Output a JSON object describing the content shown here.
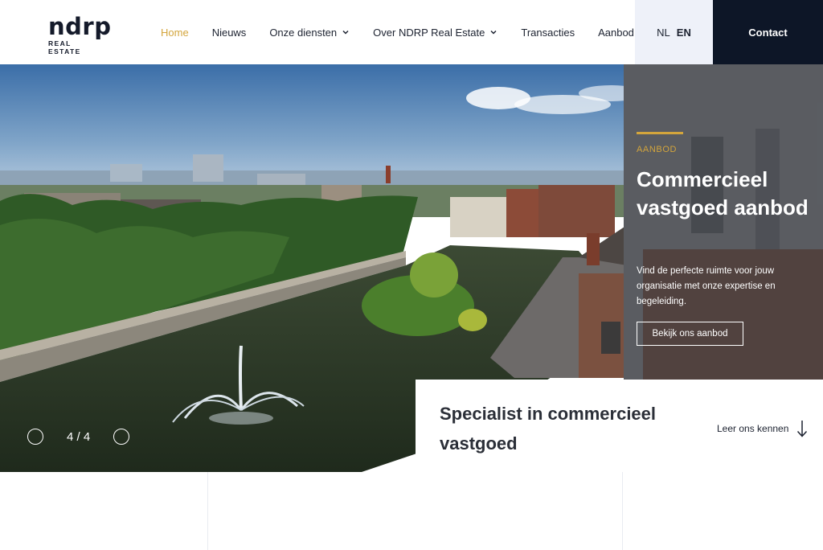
{
  "logo": {
    "main": "ndrp",
    "sub": "REAL ESTATE"
  },
  "nav": {
    "home": "Home",
    "news": "Nieuws",
    "services": "Onze diensten",
    "about": "Over NDRP Real Estate",
    "transactions": "Transacties",
    "listings": "Aanbod"
  },
  "lang": {
    "nl": "NL",
    "en": "EN",
    "active": "EN"
  },
  "contact": "Contact",
  "hero": {
    "eyebrow": "AANBOD",
    "heading": "Commercieel vastgoed aanbod",
    "text": "Vind de perfecte ruimte voor jouw organisatie met onze expertise en begeleiding.",
    "button": "Bekijk ons aanbod"
  },
  "slider": {
    "current": 4,
    "total": 4,
    "label": "4 / 4"
  },
  "card": {
    "title": "Specialist in commercieel vastgoed",
    "link": "Leer ons kennen"
  },
  "colors": {
    "accent": "#d3a53c",
    "navy": "#0d1627",
    "lang_bg": "#eef1f9"
  },
  "icons": [
    "chevron-down-icon",
    "arrow-down-icon",
    "circle-prev-icon",
    "circle-next-icon"
  ]
}
